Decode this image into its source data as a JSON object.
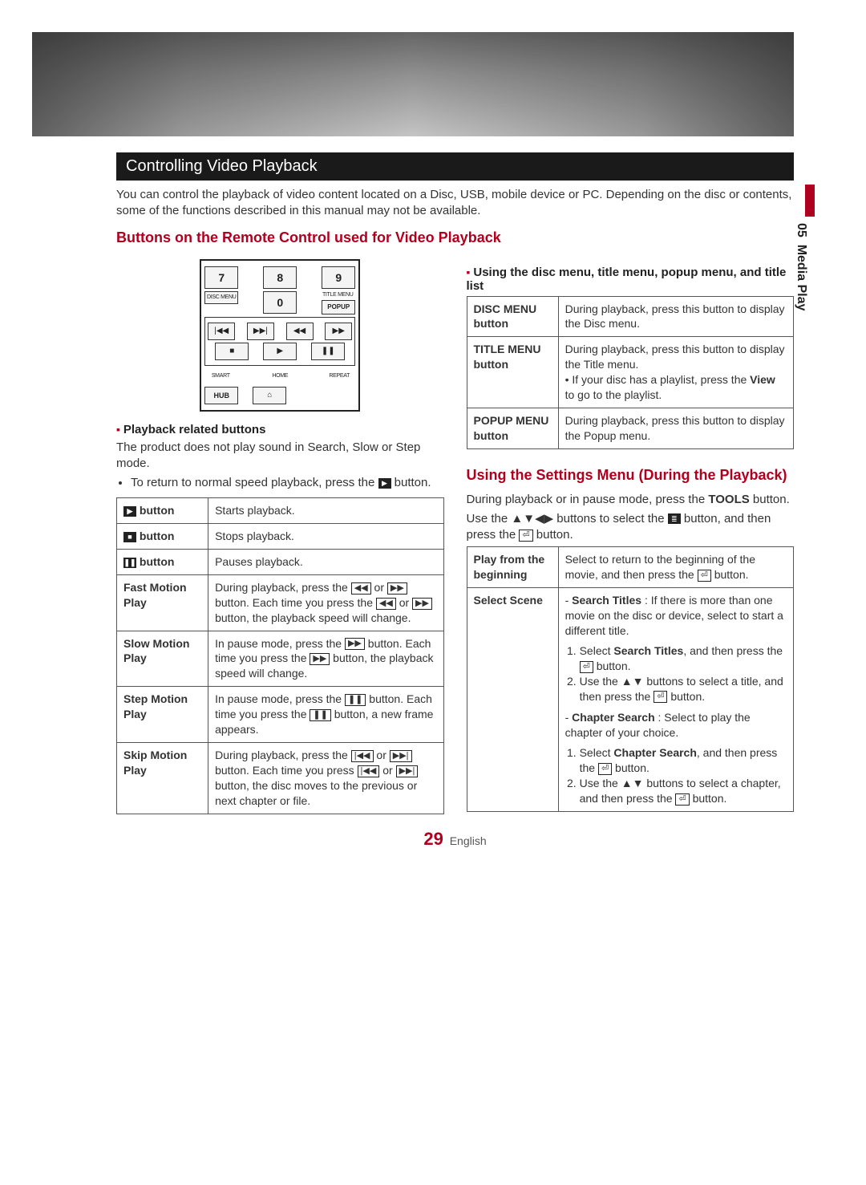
{
  "section_title": "Controlling Video Playback",
  "intro": "You can control the playback of video content located on a Disc, USB, mobile device or PC. Depending on the disc or contents, some of the functions described in this manual may not be available.",
  "subheading_remote": "Buttons on the Remote Control used for Video Playback",
  "side_tab": {
    "chapter_num": "05",
    "chapter_name": "Media Play"
  },
  "remote": {
    "row1": [
      "7",
      "8",
      "9"
    ],
    "row2_left_label": "DISC MENU",
    "row2_center": "0",
    "row2_right_label": "TITLE MENU",
    "row2_right_btn": "POPUP",
    "row3_icons": [
      "|◀◀",
      "▶▶|",
      "◀◀",
      "▶▶"
    ],
    "row4_icons": [
      "■",
      "▶",
      "❚❚"
    ],
    "row5_labels": [
      "SMART",
      "HOME",
      "REPEAT"
    ],
    "row6_left": "HUB",
    "row6_center_icon": "⌂"
  },
  "playback_related": {
    "heading": "Playback related buttons",
    "note1": "The product does not play sound in Search, Slow or Step mode.",
    "note2_pre": "To return to normal speed playback, press the ",
    "note2_post": " button.",
    "table": [
      {
        "label_icon": "▶",
        "label_suffix": " button",
        "desc": "Starts playback."
      },
      {
        "label_icon": "■",
        "label_suffix": " button",
        "desc": "Stops playback."
      },
      {
        "label_icon": "❚❚",
        "label_suffix": " button",
        "desc": "Pauses playback."
      },
      {
        "label_text": "Fast Motion Play",
        "desc_parts": [
          "During playback, press the ",
          {
            "i": "◀◀"
          },
          " or ",
          {
            "i": "▶▶"
          },
          " button.",
          " Each time you press the ",
          {
            "i": "◀◀"
          },
          " or ",
          {
            "i": "▶▶"
          },
          " button, the playback speed will change."
        ]
      },
      {
        "label_text": "Slow Motion Play",
        "desc_parts": [
          "In pause mode, press the ",
          {
            "i": "▶▶"
          },
          " button. Each time you press the ",
          {
            "i": "▶▶"
          },
          " button, the playback speed will change."
        ]
      },
      {
        "label_text": "Step Motion Play",
        "desc_parts": [
          "In pause mode, press the ",
          {
            "i": "❚❚"
          },
          " button. Each time you press the ",
          {
            "i": "❚❚"
          },
          " button, a new frame appears."
        ]
      },
      {
        "label_text": "Skip Motion Play",
        "desc_parts": [
          "During playback, press the ",
          {
            "i": "|◀◀"
          },
          " or ",
          {
            "i": "▶▶|"
          },
          " button.",
          " Each time you press ",
          {
            "i": "|◀◀"
          },
          " or ",
          {
            "i": "▶▶|"
          },
          " button, the disc moves to the previous or next chapter or file."
        ]
      }
    ]
  },
  "disc_menu_section": {
    "heading": "Using the disc menu, title menu, popup menu, and title list",
    "table": [
      {
        "label": "DISC MENU button",
        "desc": "During playback, press this button to display the Disc menu."
      },
      {
        "label": "TITLE MENU button",
        "desc_lines": [
          "During playback, press this button to display the Title menu.",
          "• If your disc has a playlist, press the View to go to the playlist."
        ],
        "bold_in_line2": "View"
      },
      {
        "label": "POPUP MENU button",
        "desc": "During playback, press this button to display the Popup menu."
      }
    ]
  },
  "settings_menu": {
    "heading": "Using the Settings Menu (During the Playback)",
    "intro1_pre": "During playback or in pause mode, press the ",
    "intro1_bold": "TOOLS",
    "intro1_post": " button.",
    "intro2_pre": "Use the ",
    "intro2_arrows": "▲▼◀▶",
    "intro2_mid": " buttons to select the ",
    "intro2_menu_icon": "≣",
    "intro2_mid2": " button, and then press the ",
    "intro2_enter_icon": "⏎",
    "intro2_post": " button.",
    "table": [
      {
        "label": "Play from the beginning",
        "desc_parts": [
          "Select to return to the beginning of the movie, and then press the ",
          {
            "i": "⏎"
          },
          " button."
        ]
      },
      {
        "label": "Select Scene",
        "desc_complex": {
          "search_titles_intro": "Search Titles : If there is more than one movie on the disc or device, select to start a different title.",
          "search_titles_steps": [
            {
              "pre": "Select ",
              "b": "Search Titles",
              "mid": ", and then press the ",
              "i": "⏎",
              "post": " button."
            },
            {
              "pre": "Use the ",
              "arr": "▲▼",
              "mid": " buttons to select a title, and then press the ",
              "i": "⏎",
              "post": " button."
            }
          ],
          "chapter_search_intro": "Chapter Search : Select to play the chapter of your choice.",
          "chapter_search_steps": [
            {
              "pre": "Select ",
              "b": "Chapter Search",
              "mid": ", and then press the ",
              "i": "⏎",
              "post": " button."
            },
            {
              "pre": "Use the ",
              "arr": "▲▼",
              "mid": " buttons to select a chapter, and then press the ",
              "i": "⏎",
              "post": " button."
            }
          ]
        }
      }
    ]
  },
  "page_number": "29",
  "page_lang": "English"
}
